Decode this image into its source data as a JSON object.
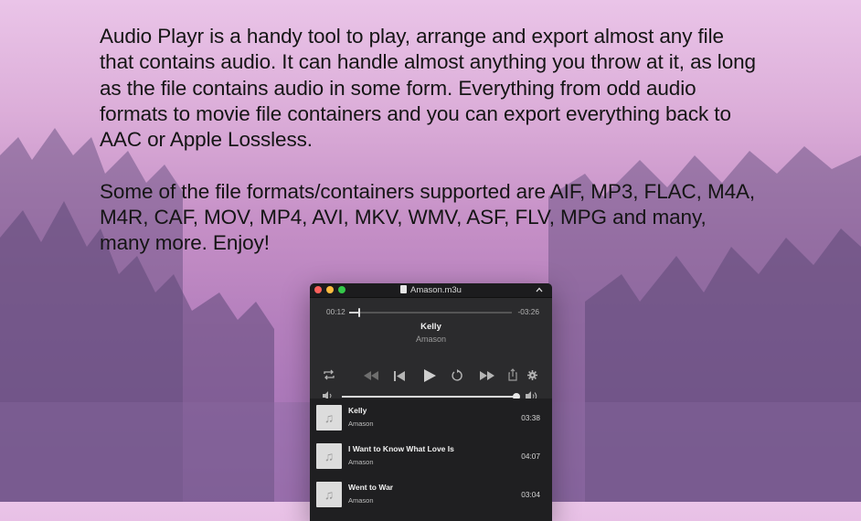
{
  "description_paragraphs": [
    "Audio Playr is a handy tool to play, arrange and export almost any file that contains audio. It can handle almost anything you throw at it, as long as the file contains audio in some form. Everything from odd audio formats to movie file containers and you can export everything back to AAC or Apple Lossless.",
    "Some of the file formats/containers supported are AIF, MP3, FLAC, M4A, M4R, CAF, MOV, MP4, AVI, MKV, WMV, ASF, FLV, MPG and many, many more. Enjoy!"
  ],
  "window": {
    "title": "Amason.m3u",
    "icons": {
      "close": "close-icon",
      "minimize": "minimize-icon",
      "zoom": "zoom-icon",
      "collapse": "chevron-up-icon",
      "document": "document-icon"
    }
  },
  "player": {
    "elapsed": "00:12",
    "remaining": "-03:26",
    "progress": 0.055,
    "track_title": "Kelly",
    "track_artist": "Amason",
    "volume": 1.0,
    "icons": [
      "repeat-icon",
      "rewind-icon",
      "previous-icon",
      "play-icon",
      "replay-icon",
      "fast-forward-icon",
      "share-icon",
      "gear-icon",
      "volume-low-icon",
      "volume-high-icon"
    ]
  },
  "playlist": [
    {
      "title": "Kelly",
      "artist": "Amason",
      "duration": "03:38",
      "icon": "music-note-icon"
    },
    {
      "title": "I Want to Know What Love Is",
      "artist": "Amason",
      "duration": "04:07",
      "icon": "music-note-icon"
    },
    {
      "title": "Went to War",
      "artist": "Amason",
      "duration": "03:04",
      "icon": "music-note-icon"
    }
  ],
  "colors": {
    "window_bg": "#2a2a2c",
    "titlebar_bg": "#1c1c1e",
    "traffic_red": "#fc605c",
    "traffic_yellow": "#fdbc40",
    "traffic_green": "#34c84a"
  }
}
